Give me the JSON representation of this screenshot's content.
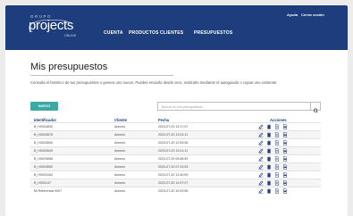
{
  "header": {
    "logo_top": "GRUPO",
    "logo_main": "projects",
    "logo_bottom": "ONLINE",
    "nav": [
      "CUENTA",
      "PRODUCTOS",
      "CLIENTES",
      "PRESUPUESTOS"
    ],
    "links": [
      "Ayuda",
      "Cerrar sesión"
    ]
  },
  "main": {
    "title": "Mis presupuestos",
    "description": "Consulta el histórico de tus presupuestos o genera uno nuevo. Puedes enviarlo desde cero, realizarlo mediante el autoguiado o copiar uno existente.",
    "new_button": "NUEVO",
    "search_placeholder": "Buscar en mis presupuestos..."
  },
  "table": {
    "headers": [
      "Identificador",
      "Cliente",
      "Fecha",
      "Acciones"
    ],
    "rows": [
      {
        "id": "B_H0004830",
        "client": "Antonio",
        "date": "2023-07-20 14:17:07"
      },
      {
        "id": "B_H0003878",
        "client": "Antonio",
        "date": "2023-07-20 13:23:11"
      },
      {
        "id": "B_H0003840",
        "client": "Antonio",
        "date": "2023-07-20 12:53:06"
      },
      {
        "id": "B_H0003649",
        "client": "Antonio",
        "date": "2023-07-20 12:01:11"
      },
      {
        "id": "B_H0003658",
        "client": "Antonio",
        "date": "2023-07-20 09:48:49"
      },
      {
        "id": "B_H0003650",
        "client": "Antonio",
        "date": "2023-07-20 07:19:53"
      },
      {
        "id": "B_H0003163",
        "client": "Antonio",
        "date": "2023-07-20 12:40:59"
      },
      {
        "id": "B_H003147",
        "client": "Antonio",
        "date": "2023-07-20 12:07:07"
      },
      {
        "id": "Mi Referencia 0007",
        "client": "Antonio",
        "date": "2023-07-20 10:03:55"
      }
    ]
  },
  "colors": {
    "header": "#1e3d7c",
    "accent": "#3ea9a2",
    "icon": "#1e3d7c"
  },
  "icons": [
    "edit-icon",
    "delete-icon",
    "document-icon",
    "pdf-icon",
    "search-icon"
  ]
}
